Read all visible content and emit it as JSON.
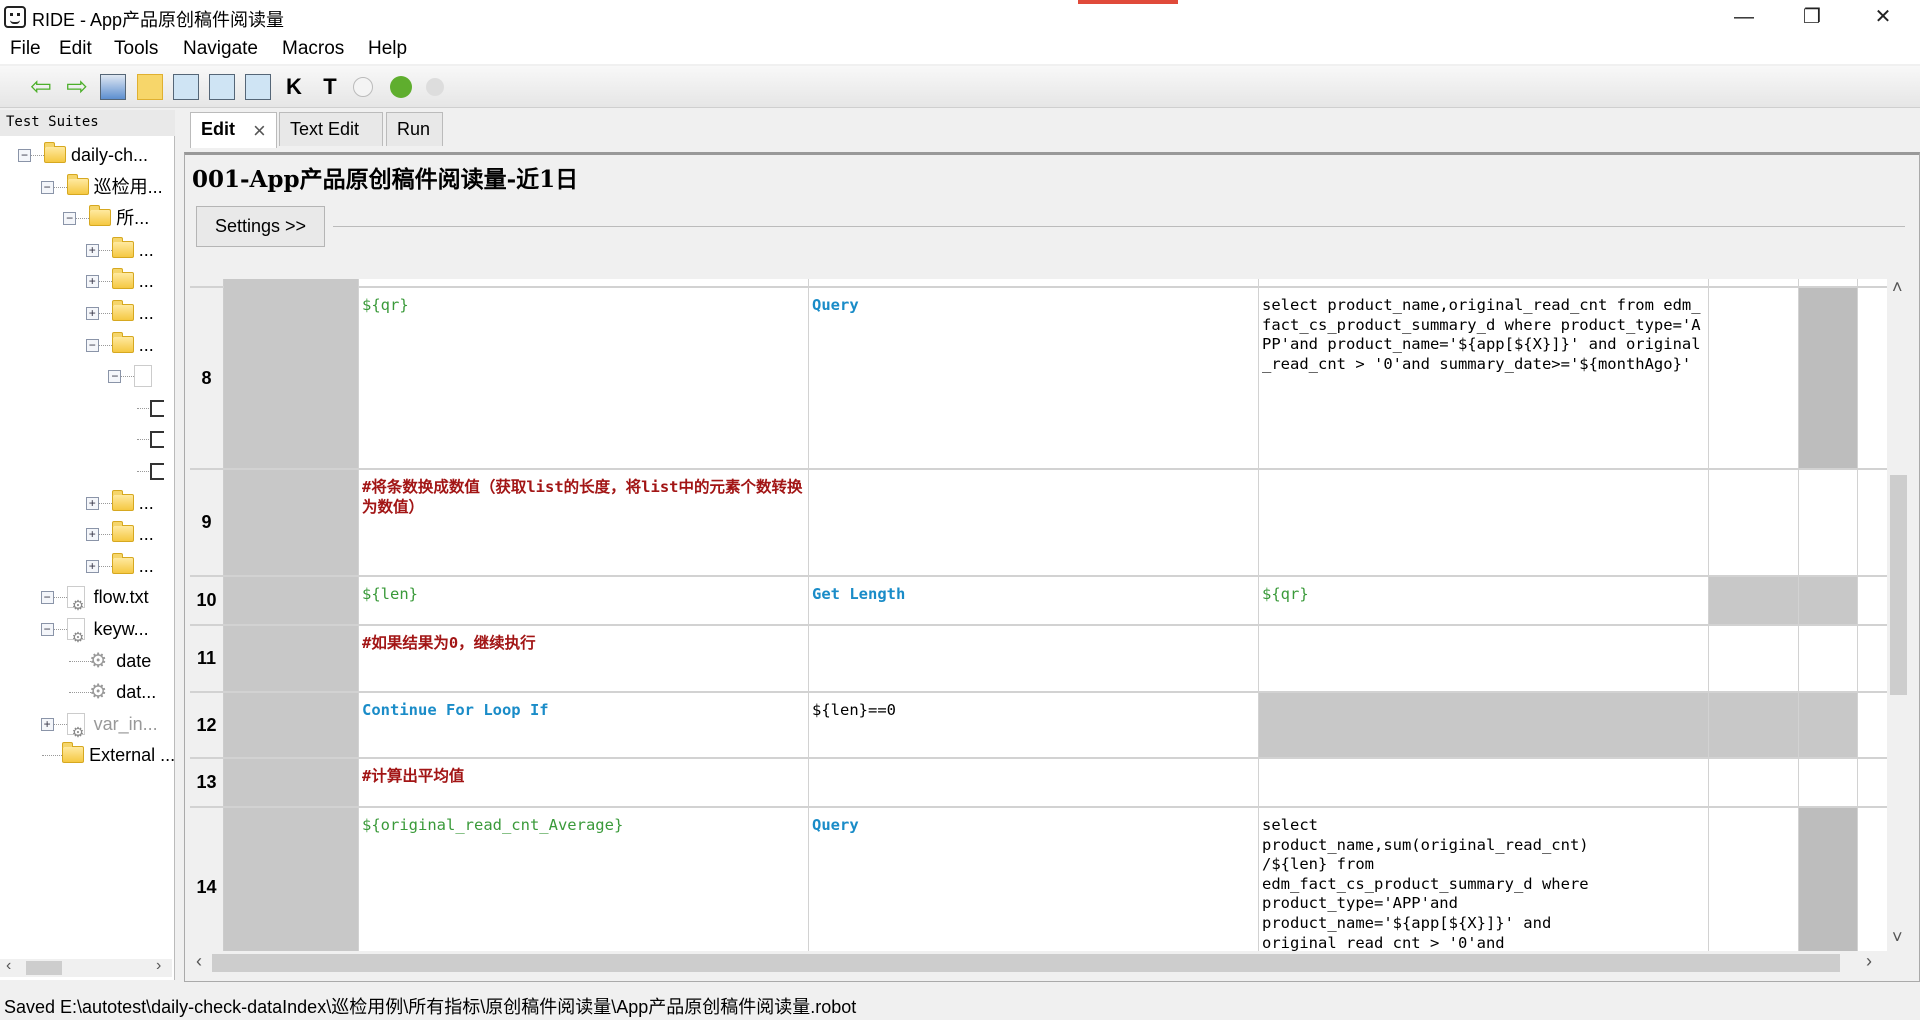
{
  "window": {
    "title": "RIDE - App产品原创稿件阅读量",
    "minimize": "—",
    "restore": "❐",
    "close": "✕"
  },
  "menu": [
    "File",
    "Edit",
    "Tools",
    "Navigate",
    "Macros",
    "Help"
  ],
  "toolbar": [
    "back-icon",
    "forward-icon",
    "open-suite-icon",
    "open-directory-icon",
    "save-icon",
    "save-all-icon",
    "save-as-icon",
    "search-keywords-icon",
    "search-tests-icon",
    "run-icon",
    "debug-icon",
    "stop-icon"
  ],
  "left_panel": {
    "header": "Test Suites",
    "tree": [
      {
        "level": 0,
        "exp": "-",
        "icon": "folder",
        "label": "daily-ch..."
      },
      {
        "level": 1,
        "exp": "-",
        "icon": "folder",
        "label": "巡检用..."
      },
      {
        "level": 2,
        "exp": "-",
        "icon": "folder",
        "label": "所..."
      },
      {
        "level": 3,
        "exp": "+",
        "icon": "folder",
        "label": "..."
      },
      {
        "level": 3,
        "exp": "+",
        "icon": "folder",
        "label": "..."
      },
      {
        "level": 3,
        "exp": "+",
        "icon": "folder",
        "label": "..."
      },
      {
        "level": 3,
        "exp": "-",
        "icon": "folder",
        "label": "..."
      },
      {
        "level": 4,
        "exp": "-",
        "icon": "page",
        "label": ""
      },
      {
        "level": 5,
        "exp": "",
        "icon": "check",
        "label": ""
      },
      {
        "level": 5,
        "exp": "",
        "icon": "check",
        "label": ""
      },
      {
        "level": 5,
        "exp": "",
        "icon": "check",
        "label": ""
      },
      {
        "level": 3,
        "exp": "+",
        "icon": "folder",
        "label": "..."
      },
      {
        "level": 3,
        "exp": "+",
        "icon": "folder",
        "label": "..."
      },
      {
        "level": 3,
        "exp": "+",
        "icon": "folder",
        "label": "..."
      },
      {
        "level": 1,
        "exp": "-",
        "icon": "gearfile",
        "label": "flow.txt"
      },
      {
        "level": 1,
        "exp": "-",
        "icon": "gearfile",
        "label": "keyw..."
      },
      {
        "level": 2,
        "exp": "",
        "icon": "gear",
        "label": "date"
      },
      {
        "level": 2,
        "exp": "",
        "icon": "gear",
        "label": "dat..."
      },
      {
        "level": 1,
        "exp": "+",
        "icon": "gearfile",
        "label": "var_in...",
        "muted": true
      },
      {
        "level": 0.8,
        "exp": "",
        "icon": "folder",
        "label": "External ..."
      }
    ]
  },
  "tabs": [
    {
      "label": "Edit",
      "close": "×"
    },
    {
      "label": "Text Edit"
    },
    {
      "label": "Run"
    }
  ],
  "editor": {
    "title": "001-App产品原创稿件阅读量-近1日",
    "settings_label": "Settings >>",
    "rows": [
      {
        "num": "",
        "cells": [
          {
            "t": ""
          },
          {
            "t": ""
          },
          {
            "t": ""
          }
        ]
      },
      {
        "num": "8",
        "cells": [
          {
            "t": "${qr}",
            "s": "var"
          },
          {
            "t": "Query",
            "s": "kw"
          },
          {
            "t": "select product_name,original_read_cnt from edm_fact_cs_product_summary_d where product_type='APP'and product_name='${app[${X}]}' and original_read_cnt > '0'and summary_date>='${monthAgo}'"
          }
        ]
      },
      {
        "num": "9",
        "cells": [
          {
            "t": "#将条数换成数值（获取list的长度，将list中的元素个数转换为数值）",
            "s": "cmt"
          },
          {
            "t": ""
          },
          {
            "t": ""
          }
        ]
      },
      {
        "num": "10",
        "cells": [
          {
            "t": "${len}",
            "s": "var"
          },
          {
            "t": "Get Length",
            "s": "kw"
          },
          {
            "t": "${qr}",
            "s": "var"
          }
        ]
      },
      {
        "num": "11",
        "cells": [
          {
            "t": "#如果结果为0，继续执行",
            "s": "cmt"
          },
          {
            "t": ""
          },
          {
            "t": ""
          }
        ]
      },
      {
        "num": "12",
        "cells": [
          {
            "t": "Continue For Loop If",
            "s": "kw"
          },
          {
            "t": "${len}==0"
          },
          {
            "t": ""
          }
        ]
      },
      {
        "num": "13",
        "cells": [
          {
            "t": "#计算出平均值",
            "s": "cmt"
          },
          {
            "t": ""
          },
          {
            "t": ""
          }
        ]
      },
      {
        "num": "14",
        "cells": [
          {
            "t": "${original_read_cnt_Average}",
            "s": "var"
          },
          {
            "t": "Query",
            "s": "kw"
          },
          {
            "t": "select\nproduct_name,sum(original_read_cnt)\n/${len} from\nedm_fact_cs_product_summary_d where\nproduct_type='APP'and\nproduct_name='${app[${X}]}' and\noriginal_read_cnt > '0'and"
          }
        ]
      }
    ]
  },
  "status": "Saved E:\\autotest\\daily-check-dataIndex\\巡检用例\\所有指标\\原创稿件阅读量\\App产品原创稿件阅读量.robot"
}
